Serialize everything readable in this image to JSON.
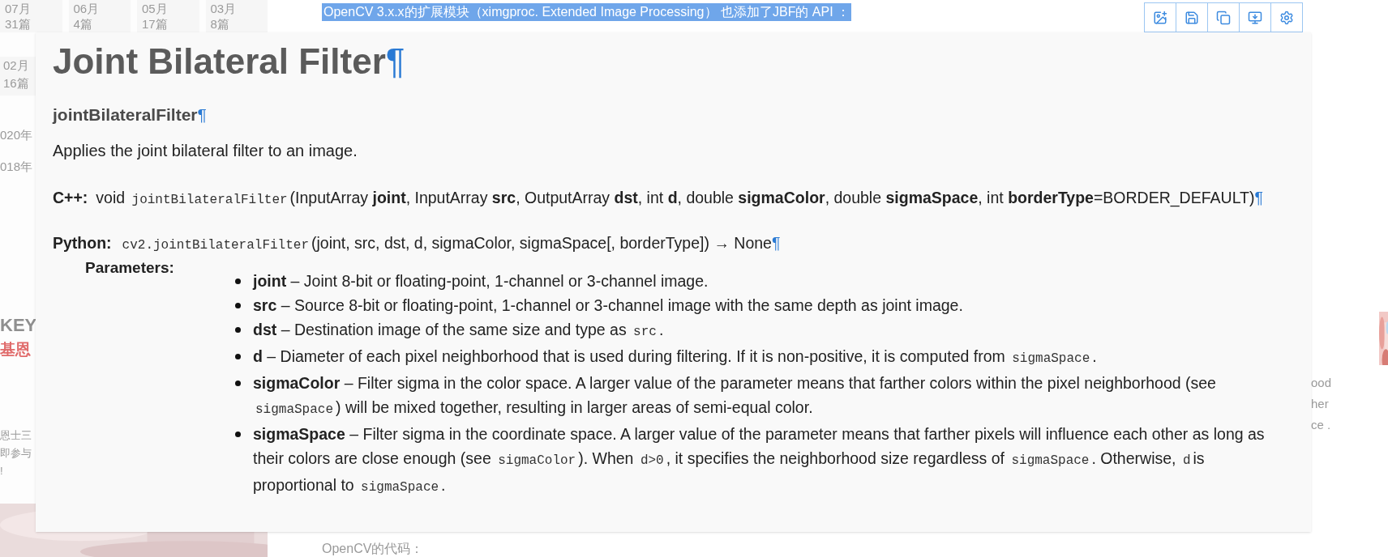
{
  "sidebar": {
    "archive": [
      {
        "month": "07月",
        "count": "31篇"
      },
      {
        "month": "06月",
        "count": "4篇"
      },
      {
        "month": "05月",
        "count": "17篇"
      },
      {
        "month": "03月",
        "count": "8篇"
      },
      {
        "month": "02月",
        "count": "16篇"
      }
    ],
    "years": [
      "020年",
      "018年"
    ],
    "ad": {
      "brand": "KEY",
      "name": "基恩",
      "kind": "picture"
    },
    "snippet_lines": [
      "恩士三",
      "即参与",
      "!"
    ]
  },
  "selected_text": "OpenCV 3.x.x的扩展模块（ximgproc. Extended Image Processing） 也添加了JBF的 API ：",
  "image_toolbar": [
    {
      "kind": "add-image"
    },
    {
      "kind": "save"
    },
    {
      "kind": "copy"
    },
    {
      "kind": "screen"
    },
    {
      "kind": "settings"
    }
  ],
  "doc_image": {
    "title": "Joint Bilateral Filter",
    "title_anchor": "¶",
    "function_name": "jointBilateralFilter",
    "function_anchor": "¶",
    "summary": "Applies the joint bilateral filter to an image.",
    "cpp": {
      "label": "C++:",
      "segments": [
        {
          "kind": "text",
          "text": "void "
        },
        {
          "kind": "code",
          "text": "jointBilateralFilter"
        },
        {
          "kind": "text",
          "text": "(InputArray **joint**, InputArray **src**, OutputArray **dst**, int **d**, double **sigmaColor**, double **sigmaSpace**, int **borderType**=BORDER_DEFAULT)"
        },
        {
          "kind": "anchor",
          "text": "¶"
        }
      ]
    },
    "python": {
      "label": "Python:",
      "segments": [
        {
          "kind": "code",
          "text": "cv2.jointBilateralFilter"
        },
        {
          "kind": "text",
          "text": "(joint, src, dst, d, sigmaColor, sigmaSpace[, borderType]) → None"
        },
        {
          "kind": "anchor",
          "text": "¶"
        }
      ]
    },
    "parameters_label": "Parameters:",
    "parameters": [
      {
        "segments": [
          {
            "kind": "text",
            "text": "**joint** – Joint 8-bit or floating-point, 1-channel or 3-channel image."
          }
        ]
      },
      {
        "segments": [
          {
            "kind": "text",
            "text": "**src** – Source 8-bit or floating-point, 1-channel or 3-channel image with the same depth as joint image."
          }
        ]
      },
      {
        "segments": [
          {
            "kind": "text",
            "text": "**dst** – Destination image of the same size and type as "
          },
          {
            "kind": "code",
            "text": "src"
          },
          {
            "kind": "text",
            "text": "."
          }
        ]
      },
      {
        "segments": [
          {
            "kind": "text",
            "text": "**d** – Diameter of each pixel neighborhood that is used during filtering. If it is non-positive, it is computed from "
          },
          {
            "kind": "code",
            "text": "sigmaSpace"
          },
          {
            "kind": "text",
            "text": "."
          }
        ]
      },
      {
        "segments": [
          {
            "kind": "text",
            "text": "**sigmaColor** – Filter sigma in the color space. A larger value of the parameter means that farther colors within the pixel neighborhood (see "
          },
          {
            "kind": "code",
            "text": "sigmaSpace"
          },
          {
            "kind": "text",
            "text": ") will be mixed together, resulting in larger areas of semi-equal color."
          }
        ]
      },
      {
        "segments": [
          {
            "kind": "text",
            "text": "**sigmaSpace** – Filter sigma in the coordinate space. A larger value of the parameter means that farther pixels will influence each other as long as their colors are close enough (see "
          },
          {
            "kind": "code",
            "text": "sigmaColor"
          },
          {
            "kind": "text",
            "text": "). When "
          },
          {
            "kind": "code",
            "text": "d>0"
          },
          {
            "kind": "text",
            "text": ", it specifies the neighborhood size regardless of "
          },
          {
            "kind": "code",
            "text": "sigmaSpace"
          },
          {
            "kind": "text",
            "text": ". Otherwise, "
          },
          {
            "kind": "code",
            "text": "d"
          },
          {
            "kind": "text",
            "text": "is proportional to "
          },
          {
            "kind": "code",
            "text": "sigmaSpace"
          },
          {
            "kind": "text",
            "text": "."
          }
        ]
      }
    ]
  },
  "right_fragments": [
    "ood",
    "her",
    "ce ."
  ],
  "side_picture": {
    "kind": "picture"
  },
  "next_heading": "OpenCV的代码："
}
